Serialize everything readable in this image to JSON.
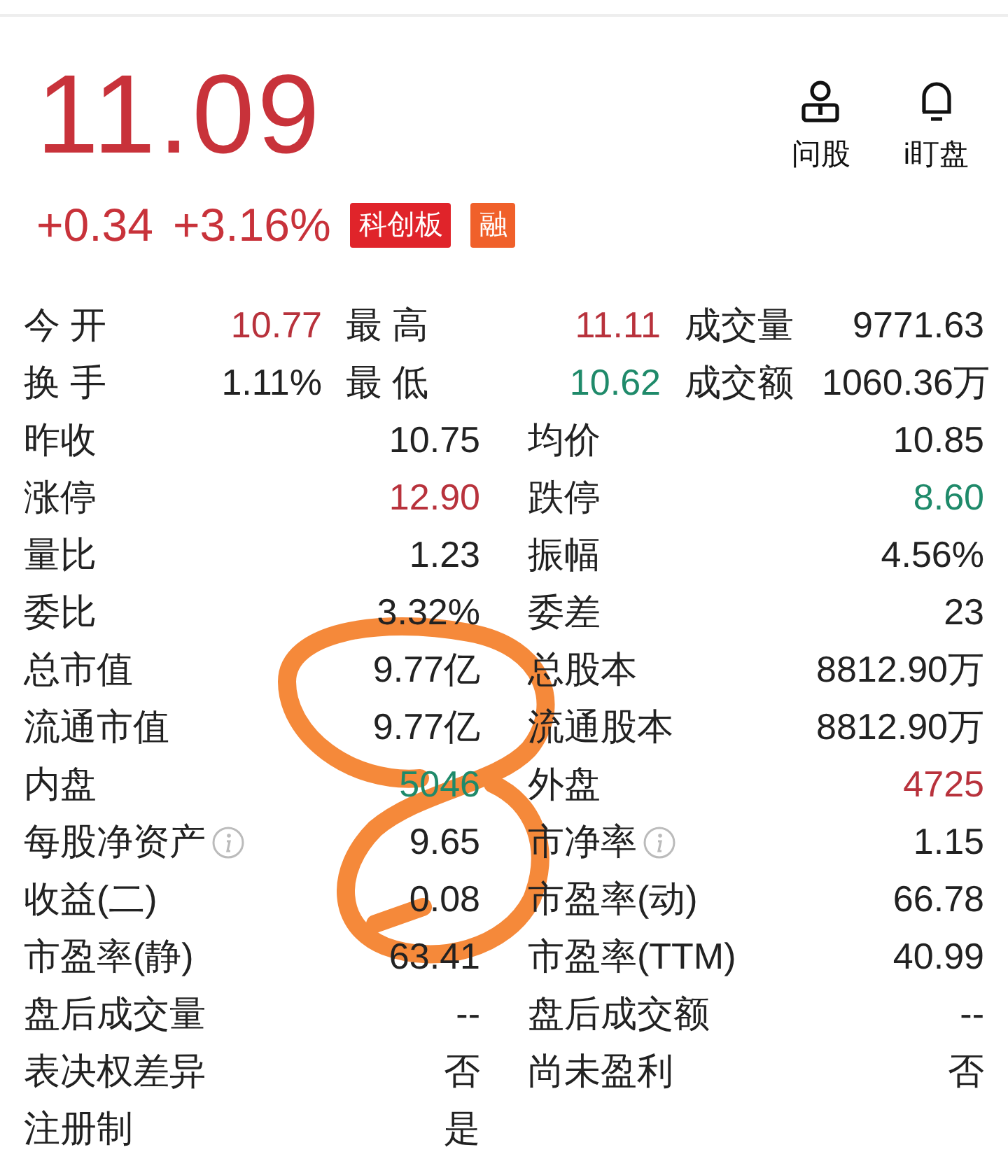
{
  "header": {
    "price": "11.09",
    "change": "+0.34",
    "change_pct": "+3.16%",
    "tags": [
      {
        "text": "科创板",
        "color": "#e0242a"
      },
      {
        "text": "融",
        "color": "#f0602a"
      }
    ],
    "actions": [
      {
        "label": "问股",
        "kind": "advisor"
      },
      {
        "label": "i盯盘",
        "kind": "bell"
      }
    ]
  },
  "top_rows": [
    [
      {
        "label": "今 开",
        "value": "10.77",
        "color": "#b8323c"
      },
      {
        "label": "最 高",
        "value": "11.11",
        "color": "#b8323c"
      },
      {
        "label": "成交量",
        "value": "9771.63",
        "color": "#222222"
      }
    ],
    [
      {
        "label": "换 手",
        "value": "1.11%",
        "color": "#222222"
      },
      {
        "label": "最 低",
        "value": "10.62",
        "color": "#1f8a6a"
      },
      {
        "label": "成交额",
        "value": "1060.36万",
        "color": "#222222"
      }
    ]
  ],
  "rows": [
    [
      {
        "label": "昨收",
        "value": "10.75",
        "color": "#222222"
      },
      {
        "label": "均价",
        "value": "10.85",
        "color": "#222222"
      }
    ],
    [
      {
        "label": "涨停",
        "value": "12.90",
        "color": "#b8323c"
      },
      {
        "label": "跌停",
        "value": "8.60",
        "color": "#1f8a6a"
      }
    ],
    [
      {
        "label": "量比",
        "value": "1.23",
        "color": "#222222"
      },
      {
        "label": "振幅",
        "value": "4.56%",
        "color": "#222222"
      }
    ],
    [
      {
        "label": "委比",
        "value": "3.32%",
        "color": "#222222"
      },
      {
        "label": "委差",
        "value": "23",
        "color": "#222222"
      }
    ],
    [
      {
        "label": "总市值",
        "value": "9.77亿",
        "color": "#222222"
      },
      {
        "label": "总股本",
        "value": "8812.90万",
        "color": "#222222"
      }
    ],
    [
      {
        "label": "流通市值",
        "value": "9.77亿",
        "color": "#222222"
      },
      {
        "label": "流通股本",
        "value": "8812.90万",
        "color": "#222222"
      }
    ],
    [
      {
        "label": "内盘",
        "value": "5046",
        "color": "#1f8a6a"
      },
      {
        "label": "外盘",
        "value": "4725",
        "color": "#b8323c"
      }
    ],
    [
      {
        "label": "每股净资产",
        "value": "9.65",
        "color": "#222222",
        "info": true
      },
      {
        "label": "市净率",
        "value": "1.15",
        "color": "#222222",
        "info": true
      }
    ],
    [
      {
        "label": "收益(二)",
        "value": "0.08",
        "color": "#222222"
      },
      {
        "label": "市盈率(动)",
        "value": "66.78",
        "color": "#222222"
      }
    ],
    [
      {
        "label": "市盈率(静)",
        "value": "63.41",
        "color": "#222222"
      },
      {
        "label": "市盈率(TTM)",
        "value": "40.99",
        "color": "#222222"
      }
    ],
    [
      {
        "label": "盘后成交量",
        "value": "--",
        "color": "#222222"
      },
      {
        "label": "盘后成交额",
        "value": "--",
        "color": "#222222"
      }
    ],
    [
      {
        "label": "表决权差异",
        "value": "否",
        "color": "#222222"
      },
      {
        "label": "尚未盈利",
        "value": "否",
        "color": "#222222"
      }
    ],
    [
      {
        "label": "注册制",
        "value": "是",
        "color": "#222222"
      }
    ]
  ],
  "annotation": {
    "kind": "scribble"
  }
}
